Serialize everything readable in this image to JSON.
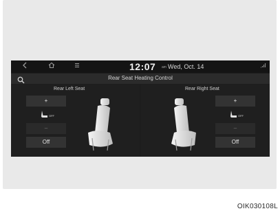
{
  "status_bar": {
    "back_icon": "chevron-left-icon",
    "home_icon": "home-icon",
    "menu_icon": "hamburger-menu-icon",
    "time": "12:07",
    "ampm": "am",
    "date": "Wed, Oct. 14",
    "signal_icon": "signal-icon"
  },
  "header": {
    "search_icon": "search-icon",
    "title": "Rear Seat Heating Control"
  },
  "left_seat": {
    "label": "Rear Left Seat",
    "plus_label": "+",
    "heat_status": "OFF",
    "minus_label": "–",
    "off_label": "Off"
  },
  "right_seat": {
    "label": "Rear Right Seat",
    "plus_label": "+",
    "heat_status": "OFF",
    "minus_label": "–",
    "off_label": "Off"
  },
  "image_code": "OIK030108L",
  "colors": {
    "screen_bg": "#1d1d1d",
    "button_bg": "#333333",
    "text": "#e6e6e6"
  }
}
